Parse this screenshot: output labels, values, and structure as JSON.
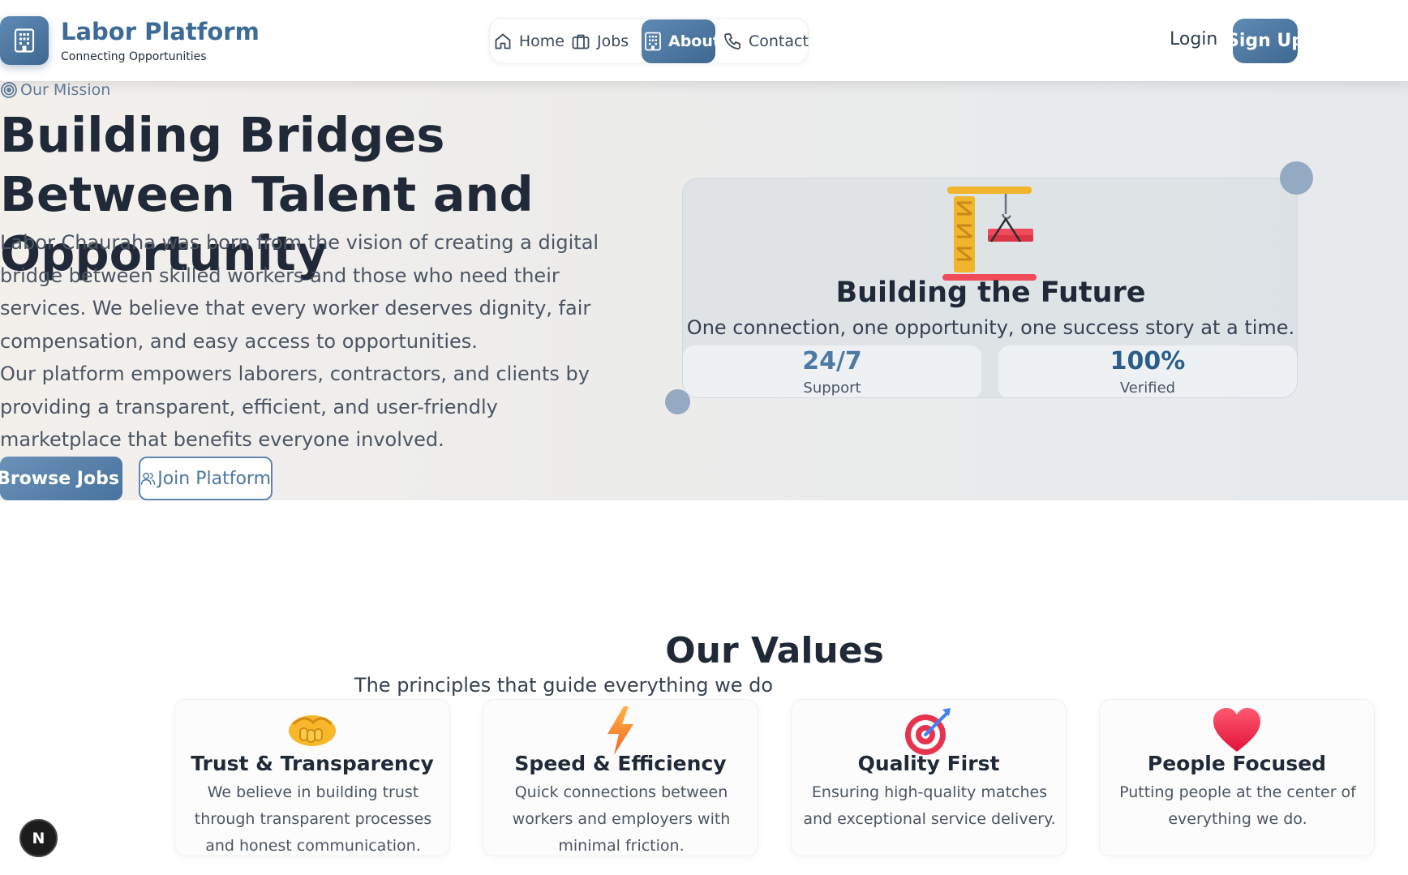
{
  "brand": {
    "title": "Labor Platform",
    "subtitle": "Connecting Opportunities",
    "icon": "building-icon"
  },
  "nav": {
    "items": [
      {
        "label": "Home",
        "icon": "home-icon",
        "active": false
      },
      {
        "label": "Jobs",
        "icon": "briefcase-icon",
        "active": false
      },
      {
        "label": "About",
        "icon": "building-icon",
        "active": true
      },
      {
        "label": "Contact",
        "icon": "phone-icon",
        "active": false
      }
    ]
  },
  "auth": {
    "login": "Login",
    "signup": "Sign Up"
  },
  "hero": {
    "badge": "Our Mission",
    "title": "Building Bridges Between Talent and Opportunity",
    "paragraph1": "Labor Chauraha was born from the vision of creating a digital bridge between skilled workers and those who need their services. We believe that every worker deserves dignity, fair compensation, and easy access to opportunities.",
    "paragraph2": "Our platform empowers laborers, contractors, and clients by providing a transparent, efficient, and user-friendly marketplace that benefits everyone involved.",
    "browse_button": "Browse Jobs",
    "join_button": "Join Platform"
  },
  "future_card": {
    "icon": "crane-icon",
    "title": "Building the Future",
    "subtitle": "One connection, one opportunity, one success story at a time.",
    "stats": [
      {
        "value": "24/7",
        "label": "Support"
      },
      {
        "value": "100%",
        "label": "Verified"
      }
    ]
  },
  "values": {
    "title": "Our Values",
    "subtitle": "The principles that guide everything we do",
    "cards": [
      {
        "icon": "handshake-icon",
        "title": "Trust & Transparency",
        "description": "We believe in building trust through transparent processes and honest communication."
      },
      {
        "icon": "lightning-icon",
        "title": "Speed & Efficiency",
        "description": "Quick connections between workers and employers with minimal friction."
      },
      {
        "icon": "target-icon",
        "title": "Quality First",
        "description": "Ensuring high-quality matches and exceptional service delivery."
      },
      {
        "icon": "heart-icon",
        "title": "People Focused",
        "description": "Putting people at the center of everything we do."
      }
    ]
  },
  "dev_badge": "N",
  "colors": {
    "accent": "#4a76a0",
    "accent_dark": "#3d6b97",
    "text": "#1f2937"
  }
}
